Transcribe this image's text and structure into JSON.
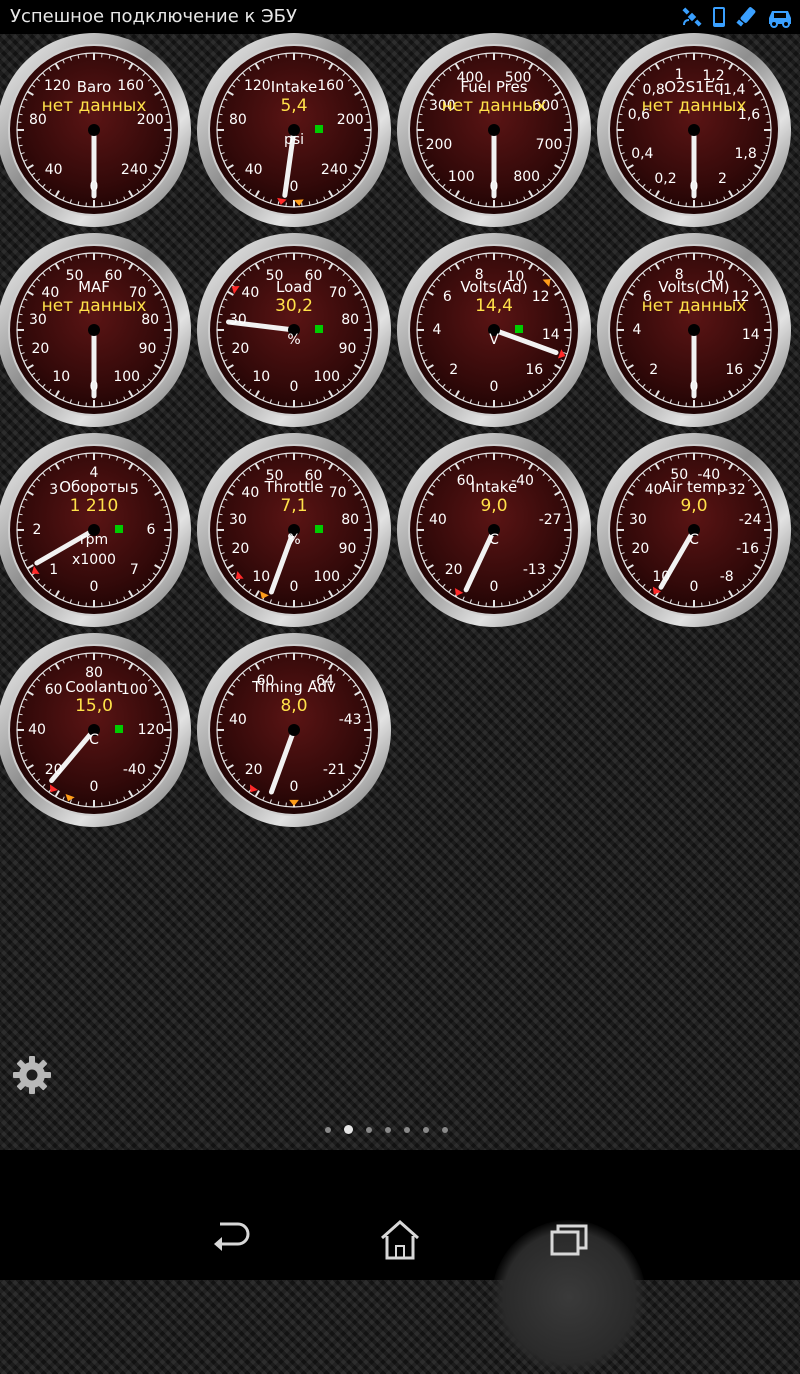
{
  "status_bar": {
    "text": "Успешное подключение к ЭБУ",
    "icons": [
      "gps-icon",
      "phone-icon",
      "bluetooth-obd-icon",
      "car-icon"
    ],
    "icon_color": "#3aa0ff"
  },
  "colors": {
    "dial_face": "#3a0c0c",
    "value_text": "#ffe24a",
    "needle": "#f2f2f2",
    "indicator_green": "#00cc00",
    "marker_red": "#ff2a2a",
    "marker_orange": "#ff9e1a"
  },
  "gauges": [
    {
      "id": "baro",
      "title": "Baro",
      "value": "нет данных",
      "ticks": [
        {
          "t": "120",
          "a": -40
        },
        {
          "t": "160",
          "a": 40
        },
        {
          "t": "80",
          "a": -80
        },
        {
          "t": "200",
          "a": 80
        },
        {
          "t": "40",
          "a": -135
        },
        {
          "t": "240",
          "a": 135
        },
        {
          "t": "0",
          "a": 180
        }
      ],
      "needle": 180,
      "square": false,
      "markers": []
    },
    {
      "id": "intake",
      "title": "Intake",
      "value": "5,4",
      "unit": "psi",
      "ticks": [
        {
          "t": "120",
          "a": -40
        },
        {
          "t": "160",
          "a": 40
        },
        {
          "t": "80",
          "a": -80
        },
        {
          "t": "200",
          "a": 80
        },
        {
          "t": "40",
          "a": -135
        },
        {
          "t": "240",
          "a": 135
        },
        {
          "t": "0",
          "a": 180
        }
      ],
      "needle": 188,
      "square": true,
      "markers": [
        {
          "a": -170,
          "c": "red"
        },
        {
          "a": 176,
          "c": "orange"
        }
      ]
    },
    {
      "id": "fuel-pres",
      "title": "Fuel Pres",
      "value": "нет данных",
      "ticks": [
        {
          "t": "400",
          "a": -25
        },
        {
          "t": "500",
          "a": 25
        },
        {
          "t": "300",
          "a": -65
        },
        {
          "t": "600",
          "a": 65
        },
        {
          "t": "200",
          "a": -105
        },
        {
          "t": "700",
          "a": 105
        },
        {
          "t": "100",
          "a": -145
        },
        {
          "t": "800",
          "a": 145
        },
        {
          "t": "0",
          "a": 180
        }
      ],
      "needle": 180,
      "square": false,
      "markers": []
    },
    {
      "id": "o2s1eq",
      "title": "O2S1Eq",
      "value": "нет данных",
      "ticks": [
        {
          "t": "1",
          "a": -15
        },
        {
          "t": "1,2",
          "a": 20
        },
        {
          "t": "0,8",
          "a": -45
        },
        {
          "t": "1,4",
          "a": 45
        },
        {
          "t": "0,6",
          "a": -75
        },
        {
          "t": "1,6",
          "a": 75
        },
        {
          "t": "0,4",
          "a": -115
        },
        {
          "t": "1,8",
          "a": 115
        },
        {
          "t": "0,2",
          "a": -150
        },
        {
          "t": "2",
          "a": 150
        },
        {
          "t": "0",
          "a": 180
        }
      ],
      "needle": 180,
      "square": false,
      "markers": []
    },
    {
      "id": "maf",
      "title": "MAF",
      "value": "нет данных",
      "ticks": [
        {
          "t": "50",
          "a": -20
        },
        {
          "t": "60",
          "a": 20
        },
        {
          "t": "40",
          "a": -50
        },
        {
          "t": "70",
          "a": 50
        },
        {
          "t": "30",
          "a": -80
        },
        {
          "t": "80",
          "a": 80
        },
        {
          "t": "20",
          "a": -110
        },
        {
          "t": "90",
          "a": 110
        },
        {
          "t": "10",
          "a": -145
        },
        {
          "t": "100",
          "a": 145
        },
        {
          "t": "0",
          "a": 180
        }
      ],
      "needle": 180,
      "square": false,
      "markers": []
    },
    {
      "id": "load",
      "title": "Load",
      "value": "30,2",
      "unit": "%",
      "ticks": [
        {
          "t": "50",
          "a": -20
        },
        {
          "t": "60",
          "a": 20
        },
        {
          "t": "40",
          "a": -50
        },
        {
          "t": "70",
          "a": 50
        },
        {
          "t": "30",
          "a": -80
        },
        {
          "t": "80",
          "a": 80
        },
        {
          "t": "20",
          "a": -110
        },
        {
          "t": "90",
          "a": 110
        },
        {
          "t": "10",
          "a": -145
        },
        {
          "t": "100",
          "a": 145
        },
        {
          "t": "0",
          "a": 180
        }
      ],
      "needle": -83,
      "square": true,
      "markers": [
        {
          "a": -55,
          "c": "red"
        }
      ]
    },
    {
      "id": "volts-ad",
      "title": "Volts(Ad)",
      "value": "14,4",
      "unit": "V",
      "ticks": [
        {
          "t": "8",
          "a": -15
        },
        {
          "t": "10",
          "a": 22
        },
        {
          "t": "6",
          "a": -55
        },
        {
          "t": "12",
          "a": 55
        },
        {
          "t": "4",
          "a": -90
        },
        {
          "t": "14",
          "a": 95
        },
        {
          "t": "2",
          "a": -135
        },
        {
          "t": "16",
          "a": 135
        },
        {
          "t": "0",
          "a": 180
        }
      ],
      "needle": 110,
      "square": true,
      "markers": [
        {
          "a": 48,
          "c": "orange"
        },
        {
          "a": 110,
          "c": "red"
        }
      ]
    },
    {
      "id": "volts-cm",
      "title": "Volts(CM)",
      "value": "нет данных",
      "ticks": [
        {
          "t": "8",
          "a": -15
        },
        {
          "t": "10",
          "a": 22
        },
        {
          "t": "6",
          "a": -55
        },
        {
          "t": "12",
          "a": 55
        },
        {
          "t": "4",
          "a": -90
        },
        {
          "t": "14",
          "a": 95
        },
        {
          "t": "2",
          "a": -135
        },
        {
          "t": "16",
          "a": 135
        },
        {
          "t": "0",
          "a": 180
        }
      ],
      "needle": 180,
      "square": false,
      "markers": []
    },
    {
      "id": "rpm",
      "title": "Обороты",
      "value": "1 210",
      "unit": "rpm",
      "unit2": "x1000",
      "ticks": [
        {
          "t": "4",
          "a": 0
        },
        {
          "t": "3",
          "a": -45
        },
        {
          "t": "5",
          "a": 45
        },
        {
          "t": "2",
          "a": -90
        },
        {
          "t": "6",
          "a": 90
        },
        {
          "t": "1",
          "a": -135
        },
        {
          "t": "7",
          "a": 135
        },
        {
          "t": "0",
          "a": 180
        }
      ],
      "needle": -120,
      "square": true,
      "markers": [
        {
          "a": -125,
          "c": "red"
        }
      ]
    },
    {
      "id": "throttle",
      "title": "Throttle",
      "value": "7,1",
      "unit": "%",
      "ticks": [
        {
          "t": "50",
          "a": -20
        },
        {
          "t": "60",
          "a": 20
        },
        {
          "t": "40",
          "a": -50
        },
        {
          "t": "70",
          "a": 50
        },
        {
          "t": "30",
          "a": -80
        },
        {
          "t": "80",
          "a": 80
        },
        {
          "t": "20",
          "a": -110
        },
        {
          "t": "90",
          "a": 110
        },
        {
          "t": "10",
          "a": -145
        },
        {
          "t": "100",
          "a": 145
        },
        {
          "t": "0",
          "a": 180
        }
      ],
      "needle": -160,
      "square": true,
      "markers": [
        {
          "a": -130,
          "c": "red"
        },
        {
          "a": -155,
          "c": "orange"
        }
      ]
    },
    {
      "id": "intake-temp",
      "title": "Intake",
      "value": "9,0",
      "unit": "C",
      "ticks": [
        {
          "t": "60",
          "a": -30
        },
        {
          "t": "-40",
          "a": 30
        },
        {
          "t": "40",
          "a": -80
        },
        {
          "t": "-27",
          "a": 80
        },
        {
          "t": "20",
          "a": -135
        },
        {
          "t": "-13",
          "a": 135
        },
        {
          "t": "0",
          "a": 180
        }
      ],
      "needle": -155,
      "square": false,
      "markers": [
        {
          "a": -150,
          "c": "red"
        }
      ]
    },
    {
      "id": "air-temp",
      "title": "Air temp",
      "value": "9,0",
      "unit": "C",
      "ticks": [
        {
          "t": "50",
          "a": -15
        },
        {
          "t": "-40",
          "a": 15
        },
        {
          "t": "40",
          "a": -45
        },
        {
          "t": "-32",
          "a": 45
        },
        {
          "t": "30",
          "a": -80
        },
        {
          "t": "-24",
          "a": 80
        },
        {
          "t": "20",
          "a": -110
        },
        {
          "t": "-16",
          "a": 110
        },
        {
          "t": "10",
          "a": -145
        },
        {
          "t": "-8",
          "a": 145
        },
        {
          "t": "0",
          "a": 180
        }
      ],
      "needle": -150,
      "square": false,
      "markers": [
        {
          "a": -148,
          "c": "red"
        }
      ]
    },
    {
      "id": "coolant",
      "title": "Coolant",
      "value": "15,0",
      "unit": "C",
      "ticks": [
        {
          "t": "80",
          "a": 0
        },
        {
          "t": "60",
          "a": -45
        },
        {
          "t": "100",
          "a": 45
        },
        {
          "t": "40",
          "a": -90
        },
        {
          "t": "120",
          "a": 90
        },
        {
          "t": "20",
          "a": -135
        },
        {
          "t": "-40",
          "a": 135
        },
        {
          "t": "0",
          "a": 180
        }
      ],
      "needle": -140,
      "square": true,
      "markers": [
        {
          "a": -145,
          "c": "red"
        },
        {
          "a": -160,
          "c": "orange"
        }
      ]
    },
    {
      "id": "timing-adv",
      "title": "Timing Adv",
      "value": "8,0",
      "ticks": [
        {
          "t": "60",
          "a": -30
        },
        {
          "t": "-64",
          "a": 30
        },
        {
          "t": "40",
          "a": -80
        },
        {
          "t": "-43",
          "a": 80
        },
        {
          "t": "20",
          "a": -135
        },
        {
          "t": "-21",
          "a": 135
        },
        {
          "t": "0",
          "a": 180
        }
      ],
      "needle": -160,
      "square": false,
      "markers": [
        {
          "a": -145,
          "c": "red"
        },
        {
          "a": 180,
          "c": "orange"
        }
      ]
    }
  ],
  "pager": {
    "count": 7,
    "active": 1
  },
  "nav": {
    "buttons": [
      "back-icon",
      "home-icon",
      "recent-apps-icon"
    ]
  }
}
